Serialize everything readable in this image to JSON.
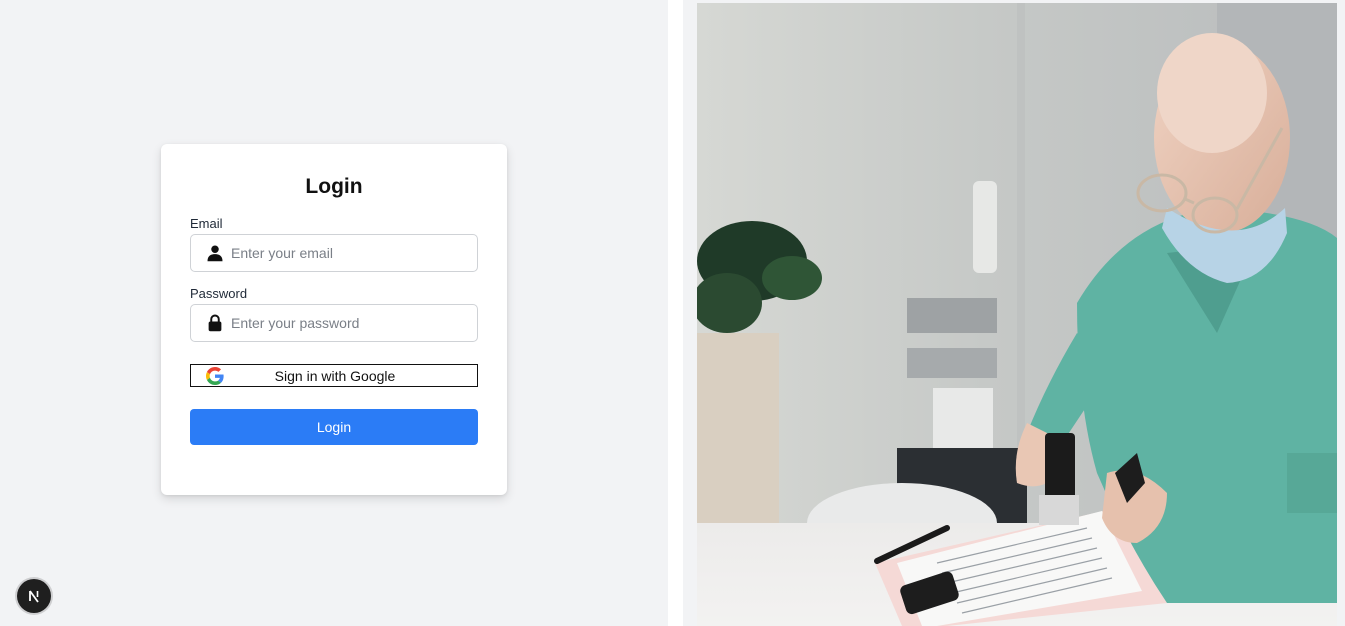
{
  "login": {
    "title": "Login",
    "email_label": "Email",
    "email_placeholder": "Enter your email",
    "password_label": "Password",
    "password_placeholder": "Enter your password",
    "google_label": "Sign in with Google",
    "submit_label": "Login"
  },
  "icons": {
    "email": "user-icon",
    "password": "lock-icon",
    "google": "google-logo-icon",
    "dev_badge": "nextjs-logo-icon"
  },
  "colors": {
    "accent": "#2b7cf6",
    "page_background": "#f2f3f5",
    "card_background": "#ffffff",
    "scrubs": "#5fb3a3"
  },
  "image": {
    "description_name": "doctor-stamping-document-photo"
  }
}
